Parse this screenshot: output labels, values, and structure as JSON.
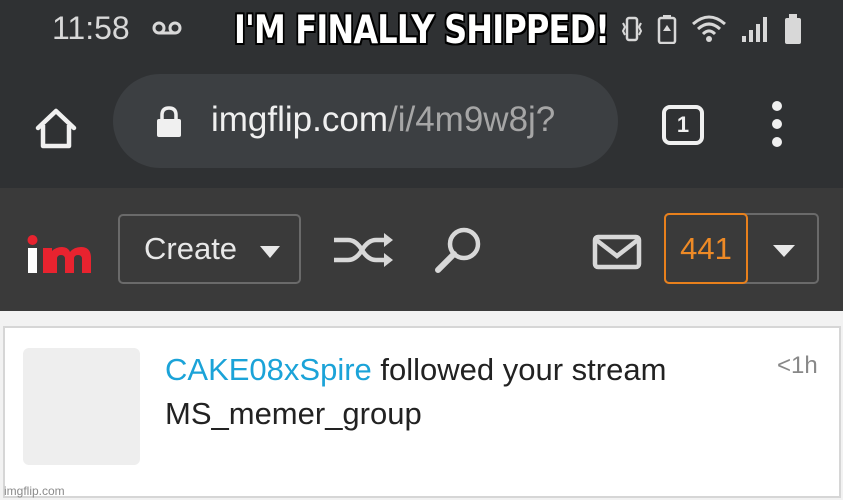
{
  "meme": {
    "caption": "I'M FINALLY SHIPPED!"
  },
  "status_bar": {
    "time": "11:58",
    "icons": [
      "voicemail-icon",
      "vibrate-icon",
      "battery-saver-icon",
      "wifi-icon",
      "signal-icon",
      "battery-icon"
    ]
  },
  "browser": {
    "url_domain": "imgflip.com",
    "url_path": "/i/4m9w8j?",
    "tab_count": "1",
    "icons": [
      "home-icon",
      "lock-icon",
      "menu-icon"
    ]
  },
  "nav": {
    "logo_text": "im",
    "create_label": "Create",
    "notification_count": "441",
    "icons": [
      "shuffle-icon",
      "search-icon",
      "mail-icon",
      "caret-down-icon"
    ],
    "colors": {
      "logo_red": "#e8232f",
      "accent_orange": "#ee8a26",
      "nav_bg": "#3a3a3a"
    }
  },
  "notification": {
    "username": "CAKE08xSpire",
    "action": " followed your stream",
    "stream_name": "MS_memer_group",
    "time": "<1h",
    "colors": {
      "link": "#1ba3d8"
    }
  },
  "watermark": "imgflip.com"
}
